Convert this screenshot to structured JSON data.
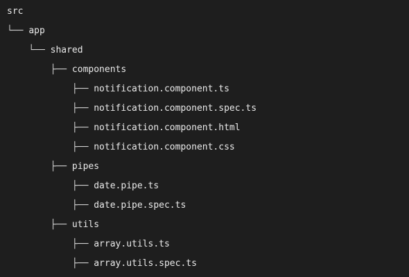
{
  "tree": {
    "lines": [
      {
        "prefix": "",
        "name": "src"
      },
      {
        "prefix": "└── ",
        "name": "app"
      },
      {
        "prefix": "    └── ",
        "name": "shared"
      },
      {
        "prefix": "        ├── ",
        "name": "components"
      },
      {
        "prefix": "            ├── ",
        "name": "notification.component.ts"
      },
      {
        "prefix": "            ├── ",
        "name": "notification.component.spec.ts"
      },
      {
        "prefix": "            ├── ",
        "name": "notification.component.html"
      },
      {
        "prefix": "            ├── ",
        "name": "notification.component.css"
      },
      {
        "prefix": "        ├── ",
        "name": "pipes"
      },
      {
        "prefix": "            ├── ",
        "name": "date.pipe.ts"
      },
      {
        "prefix": "            ├── ",
        "name": "date.pipe.spec.ts"
      },
      {
        "prefix": "        ├── ",
        "name": "utils"
      },
      {
        "prefix": "            ├── ",
        "name": "array.utils.ts"
      },
      {
        "prefix": "            ├── ",
        "name": "array.utils.spec.ts"
      }
    ]
  }
}
